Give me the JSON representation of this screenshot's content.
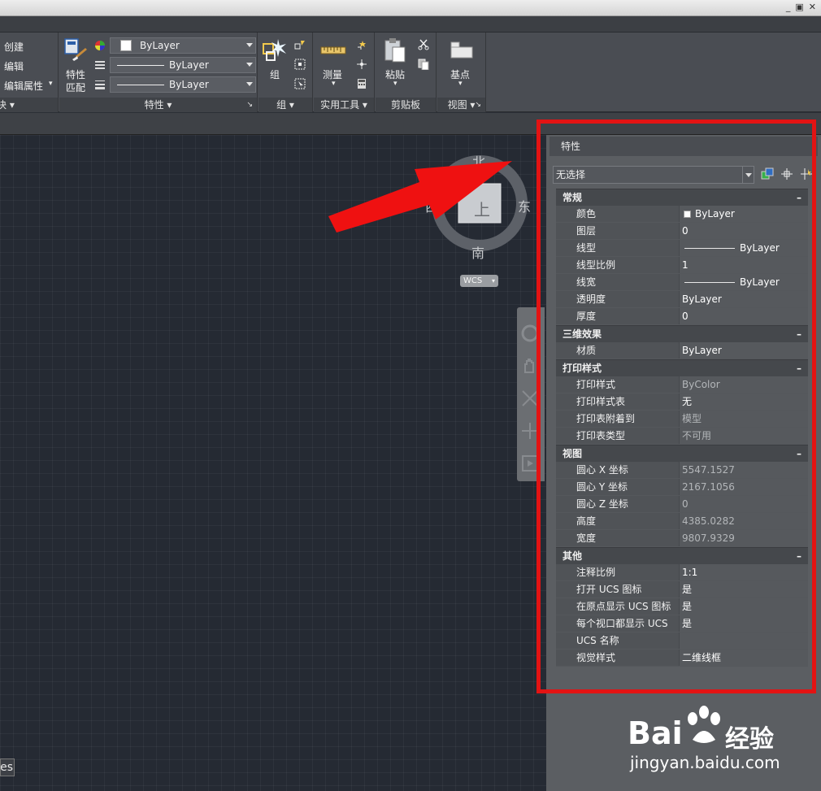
{
  "window": {
    "controls": [
      "_",
      "▣",
      "✕"
    ]
  },
  "ribbon": {
    "block_labels": [
      "创建",
      "编辑",
      "编辑属性"
    ],
    "block_panel_tail": "块",
    "match_props_label_1": "特性",
    "match_props_label_2": "匹配",
    "color_dropdown": "ByLayer",
    "linetype_dropdown": "ByLayer",
    "lineweight_dropdown": "ByLayer",
    "panels": {
      "properties": "特性",
      "group": "组",
      "utilities": "实用工具",
      "clipboard": "剪贴板",
      "view": "视图"
    },
    "group_button": "组",
    "measure_button": "测量",
    "paste_button": "粘贴",
    "base_button": "基点"
  },
  "viewcube": {
    "north": "北",
    "south": "南",
    "east": "东",
    "west": "西",
    "top": "上",
    "wcs": "WCS"
  },
  "canvas": {
    "corner_text": "es"
  },
  "properties_panel": {
    "title": "特性",
    "selection": "无选择",
    "categories": [
      {
        "name": "常规",
        "rows": [
          {
            "k": "颜色",
            "v": "ByLayer"
          },
          {
            "k": "图层",
            "v": "0"
          },
          {
            "k": "线型",
            "v": "ByLayer"
          },
          {
            "k": "线型比例",
            "v": "1"
          },
          {
            "k": "线宽",
            "v": "ByLayer"
          },
          {
            "k": "透明度",
            "v": "ByLayer"
          },
          {
            "k": "厚度",
            "v": "0"
          }
        ]
      },
      {
        "name": "三维效果",
        "rows": [
          {
            "k": "材质",
            "v": "ByLayer"
          }
        ]
      },
      {
        "name": "打印样式",
        "rows": [
          {
            "k": "打印样式",
            "v": "ByColor"
          },
          {
            "k": "打印样式表",
            "v": "无"
          },
          {
            "k": "打印表附着到",
            "v": "模型"
          },
          {
            "k": "打印表类型",
            "v": "不可用"
          }
        ]
      },
      {
        "name": "视图",
        "rows": [
          {
            "k": "圆心 X 坐标",
            "v": "5547.1527"
          },
          {
            "k": "圆心 Y 坐标",
            "v": "2167.1056"
          },
          {
            "k": "圆心 Z 坐标",
            "v": "0"
          },
          {
            "k": "高度",
            "v": "4385.0282"
          },
          {
            "k": "宽度",
            "v": "9807.9329"
          }
        ]
      },
      {
        "name": "其他",
        "rows": [
          {
            "k": "注释比例",
            "v": "1:1"
          },
          {
            "k": "打开 UCS 图标",
            "v": "是"
          },
          {
            "k": "在原点显示 UCS 图标",
            "v": "是"
          },
          {
            "k": "每个视口都显示 UCS",
            "v": "是"
          },
          {
            "k": "UCS 名称",
            "v": ""
          },
          {
            "k": "视觉样式",
            "v": "二维线框"
          }
        ]
      }
    ],
    "collapse_symbol": "–"
  },
  "watermark": {
    "brand": "Bai",
    "brand_cn": "经验",
    "url": "jingyan.baidu.com"
  },
  "colors": {
    "highlight_red": "#e31313",
    "canvas_bg": "#252a33"
  }
}
